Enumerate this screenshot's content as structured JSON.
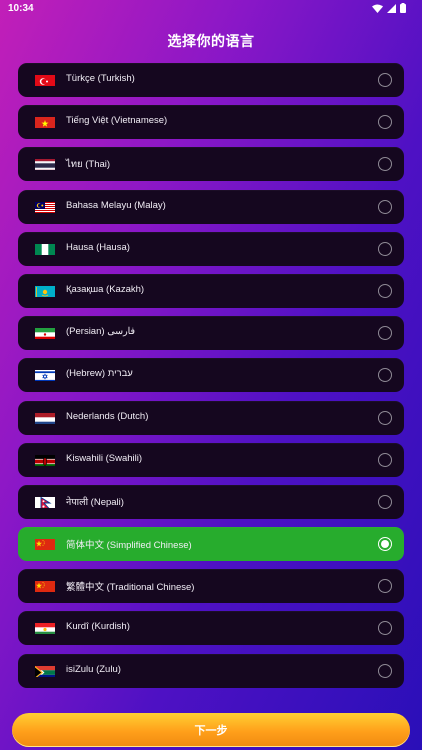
{
  "status_bar": {
    "time": "10:34",
    "icons": [
      "wifi-icon",
      "signal-icon",
      "battery-icon"
    ]
  },
  "title": "选择你的语言",
  "languages": [
    {
      "label": "Türkçe (Turkish)",
      "flag": "turkey",
      "selected": false
    },
    {
      "label": "Tiếng Việt (Vietnamese)",
      "flag": "vietnam",
      "selected": false
    },
    {
      "label": "ไทย (Thai)",
      "flag": "thailand",
      "selected": false
    },
    {
      "label": "Bahasa Melayu (Malay)",
      "flag": "malaysia",
      "selected": false
    },
    {
      "label": "Hausa (Hausa)",
      "flag": "nigeria",
      "selected": false
    },
    {
      "label": "Қазақша (Kazakh)",
      "flag": "kazakhstan",
      "selected": false
    },
    {
      "label": "(Persian) فارسی",
      "flag": "iran",
      "selected": false
    },
    {
      "label": "(Hebrew) עברית",
      "flag": "israel",
      "selected": false
    },
    {
      "label": "Nederlands (Dutch)",
      "flag": "netherlands",
      "selected": false
    },
    {
      "label": "Kiswahili (Swahili)",
      "flag": "kenya",
      "selected": false
    },
    {
      "label": "नेपाली (Nepali)",
      "flag": "nepal",
      "selected": false
    },
    {
      "label": "简体中文 (Simplified Chinese)",
      "flag": "china",
      "selected": true
    },
    {
      "label": "繁體中文 (Traditional Chinese)",
      "flag": "china",
      "selected": false
    },
    {
      "label": "Kurdî (Kurdish)",
      "flag": "kurdistan",
      "selected": false
    },
    {
      "label": "isiZulu (Zulu)",
      "flag": "south-africa",
      "selected": false
    }
  ],
  "next_button": {
    "label": "下一步"
  },
  "colors": {
    "selected_row": "#27ac2d",
    "row": "#15071f",
    "button": "#ffa61f"
  }
}
